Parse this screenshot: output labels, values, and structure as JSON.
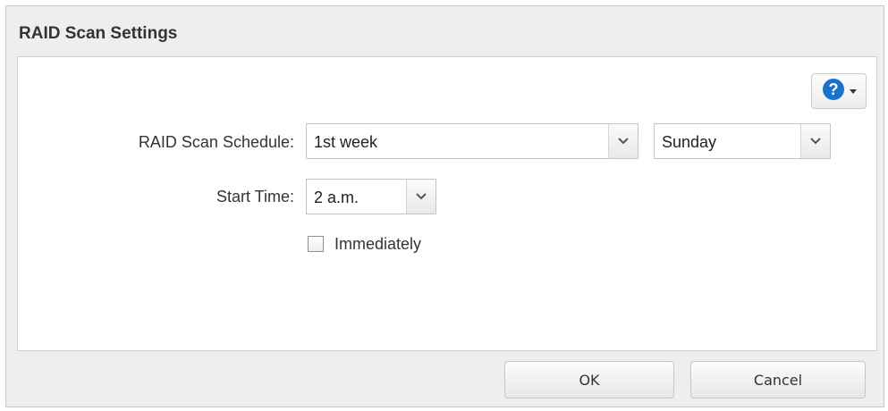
{
  "dialog": {
    "title": "RAID Scan Settings"
  },
  "help": {
    "icon": "help-circle-icon",
    "accent": "#1a73c9"
  },
  "form": {
    "schedule_label": "RAID Scan Schedule:",
    "schedule_week": "1st week",
    "schedule_day": "Sunday",
    "start_time_label": "Start Time:",
    "start_time_value": "2 a.m.",
    "immediately_label": "Immediately",
    "immediately_checked": false
  },
  "buttons": {
    "ok_label": "OK",
    "cancel_label": "Cancel"
  }
}
